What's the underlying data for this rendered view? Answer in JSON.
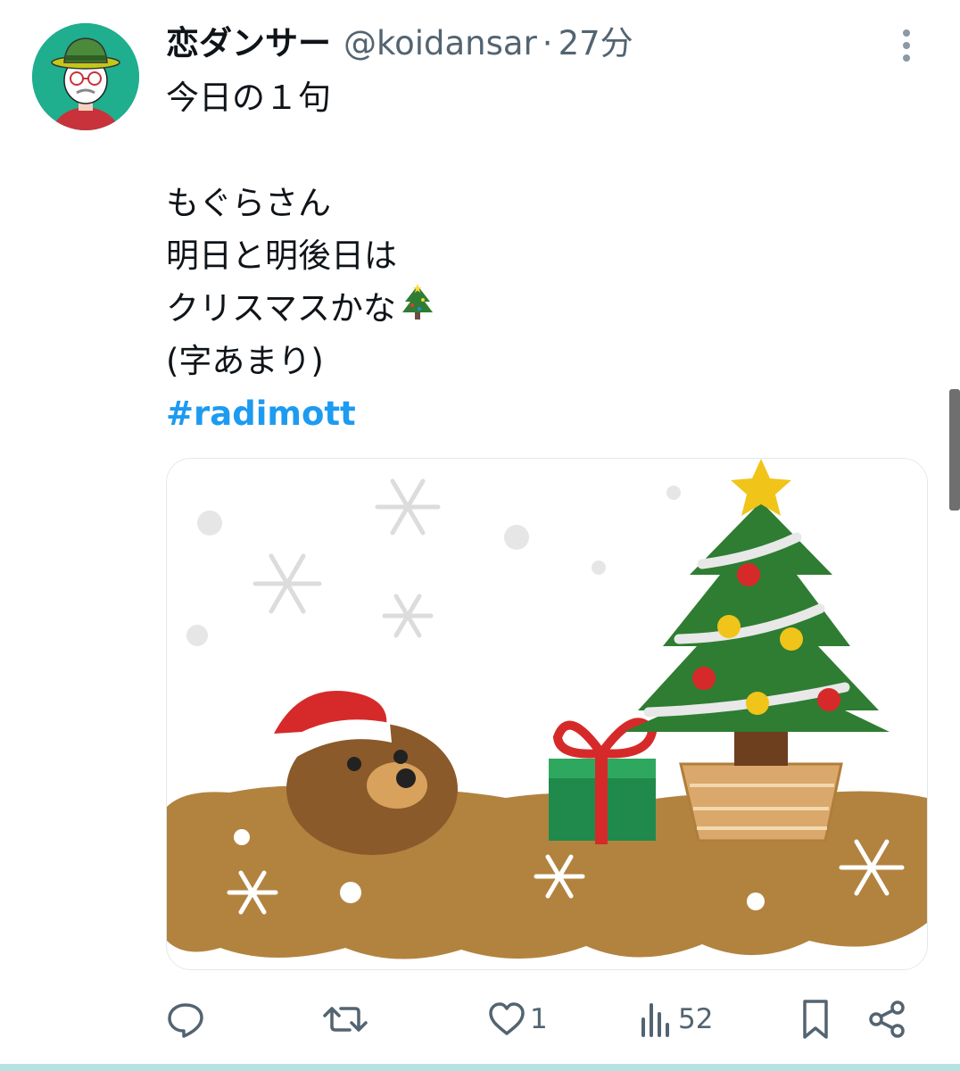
{
  "user": {
    "display_name": "恋ダンサー",
    "handle": "@koidansar",
    "separator": "·",
    "time_ago": "27分"
  },
  "tweet": {
    "lines": [
      "今日の１句",
      "",
      "もぐらさん",
      "明日と明後日は",
      "クリスマスかな",
      "(字あまり)"
    ],
    "hashtag": "#radimott",
    "emoji_icon": "christmas-tree-icon"
  },
  "media": {
    "icon": "mole-christmas-illustration"
  },
  "actions": {
    "reply": {
      "icon": "reply-icon"
    },
    "retweet": {
      "icon": "retweet-icon"
    },
    "like": {
      "icon": "heart-icon",
      "count": "1"
    },
    "views": {
      "icon": "views-chart-icon",
      "count": "52"
    },
    "bookmark": {
      "icon": "bookmark-icon"
    },
    "share": {
      "icon": "share-icon"
    }
  },
  "colors": {
    "accent": "#1d9bf0",
    "secondary_text": "#536471",
    "text": "#0f1419"
  }
}
